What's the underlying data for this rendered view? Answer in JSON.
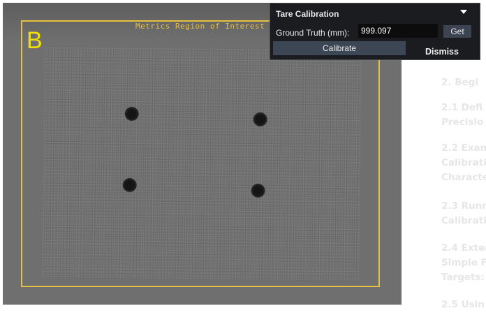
{
  "viewer": {
    "panel_letter": "B",
    "roi_label": "Metrics Region of Interest"
  },
  "dialog": {
    "title": "Tare Calibration",
    "ground_truth_label": "Ground Truth (mm):",
    "ground_truth_value": "999.097",
    "get_label": "Get",
    "calibrate_label": "Calibrate",
    "dismiss_label": "Dismiss"
  },
  "doc": {
    "sec1": [
      "2. Begi"
    ],
    "sec2": [
      "2.1 Defi",
      "Precisio"
    ],
    "sec3": [
      "2.2 Exam",
      "Calibrati",
      "Characte"
    ],
    "sec4": [
      "2.3 Runr",
      "Calibrati"
    ],
    "sec5": [
      "2.4 Exter",
      "Simple F",
      "Targets:"
    ],
    "sec6": [
      "2.5 Usin"
    ]
  },
  "colors": {
    "roi": "#e8c040",
    "panel_letter": "#f2e100",
    "dialog_bg": "#1b1c1f",
    "button_bg": "#3d4654"
  }
}
